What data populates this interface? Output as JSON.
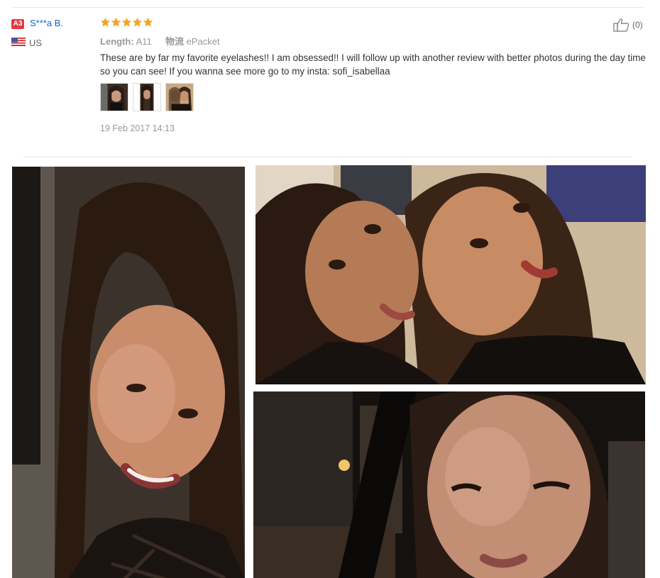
{
  "review": {
    "badge": "A3",
    "reviewer": "S***a B.",
    "country": "US",
    "rating": 5,
    "length_label": "Length:",
    "length_value": "A11",
    "shipping_label": "物流",
    "shipping_value": "ePacket",
    "text": "These are by far my favorite eyelashes!! I am obsessed!! I will follow up with another review with better photos during the day time so you can see! If you wanna see more go to my insta: sofi_isabellaa",
    "date": "19 Feb 2017 14:13",
    "helpful_count": "(0)",
    "thumbnail_count": 3
  },
  "colors": {
    "accent_name": "#0b68c6",
    "star": "#f4a21f",
    "badge": "#e4393c"
  },
  "icons": [
    "star-icon",
    "us-flag-icon",
    "thumbs-up-icon"
  ]
}
